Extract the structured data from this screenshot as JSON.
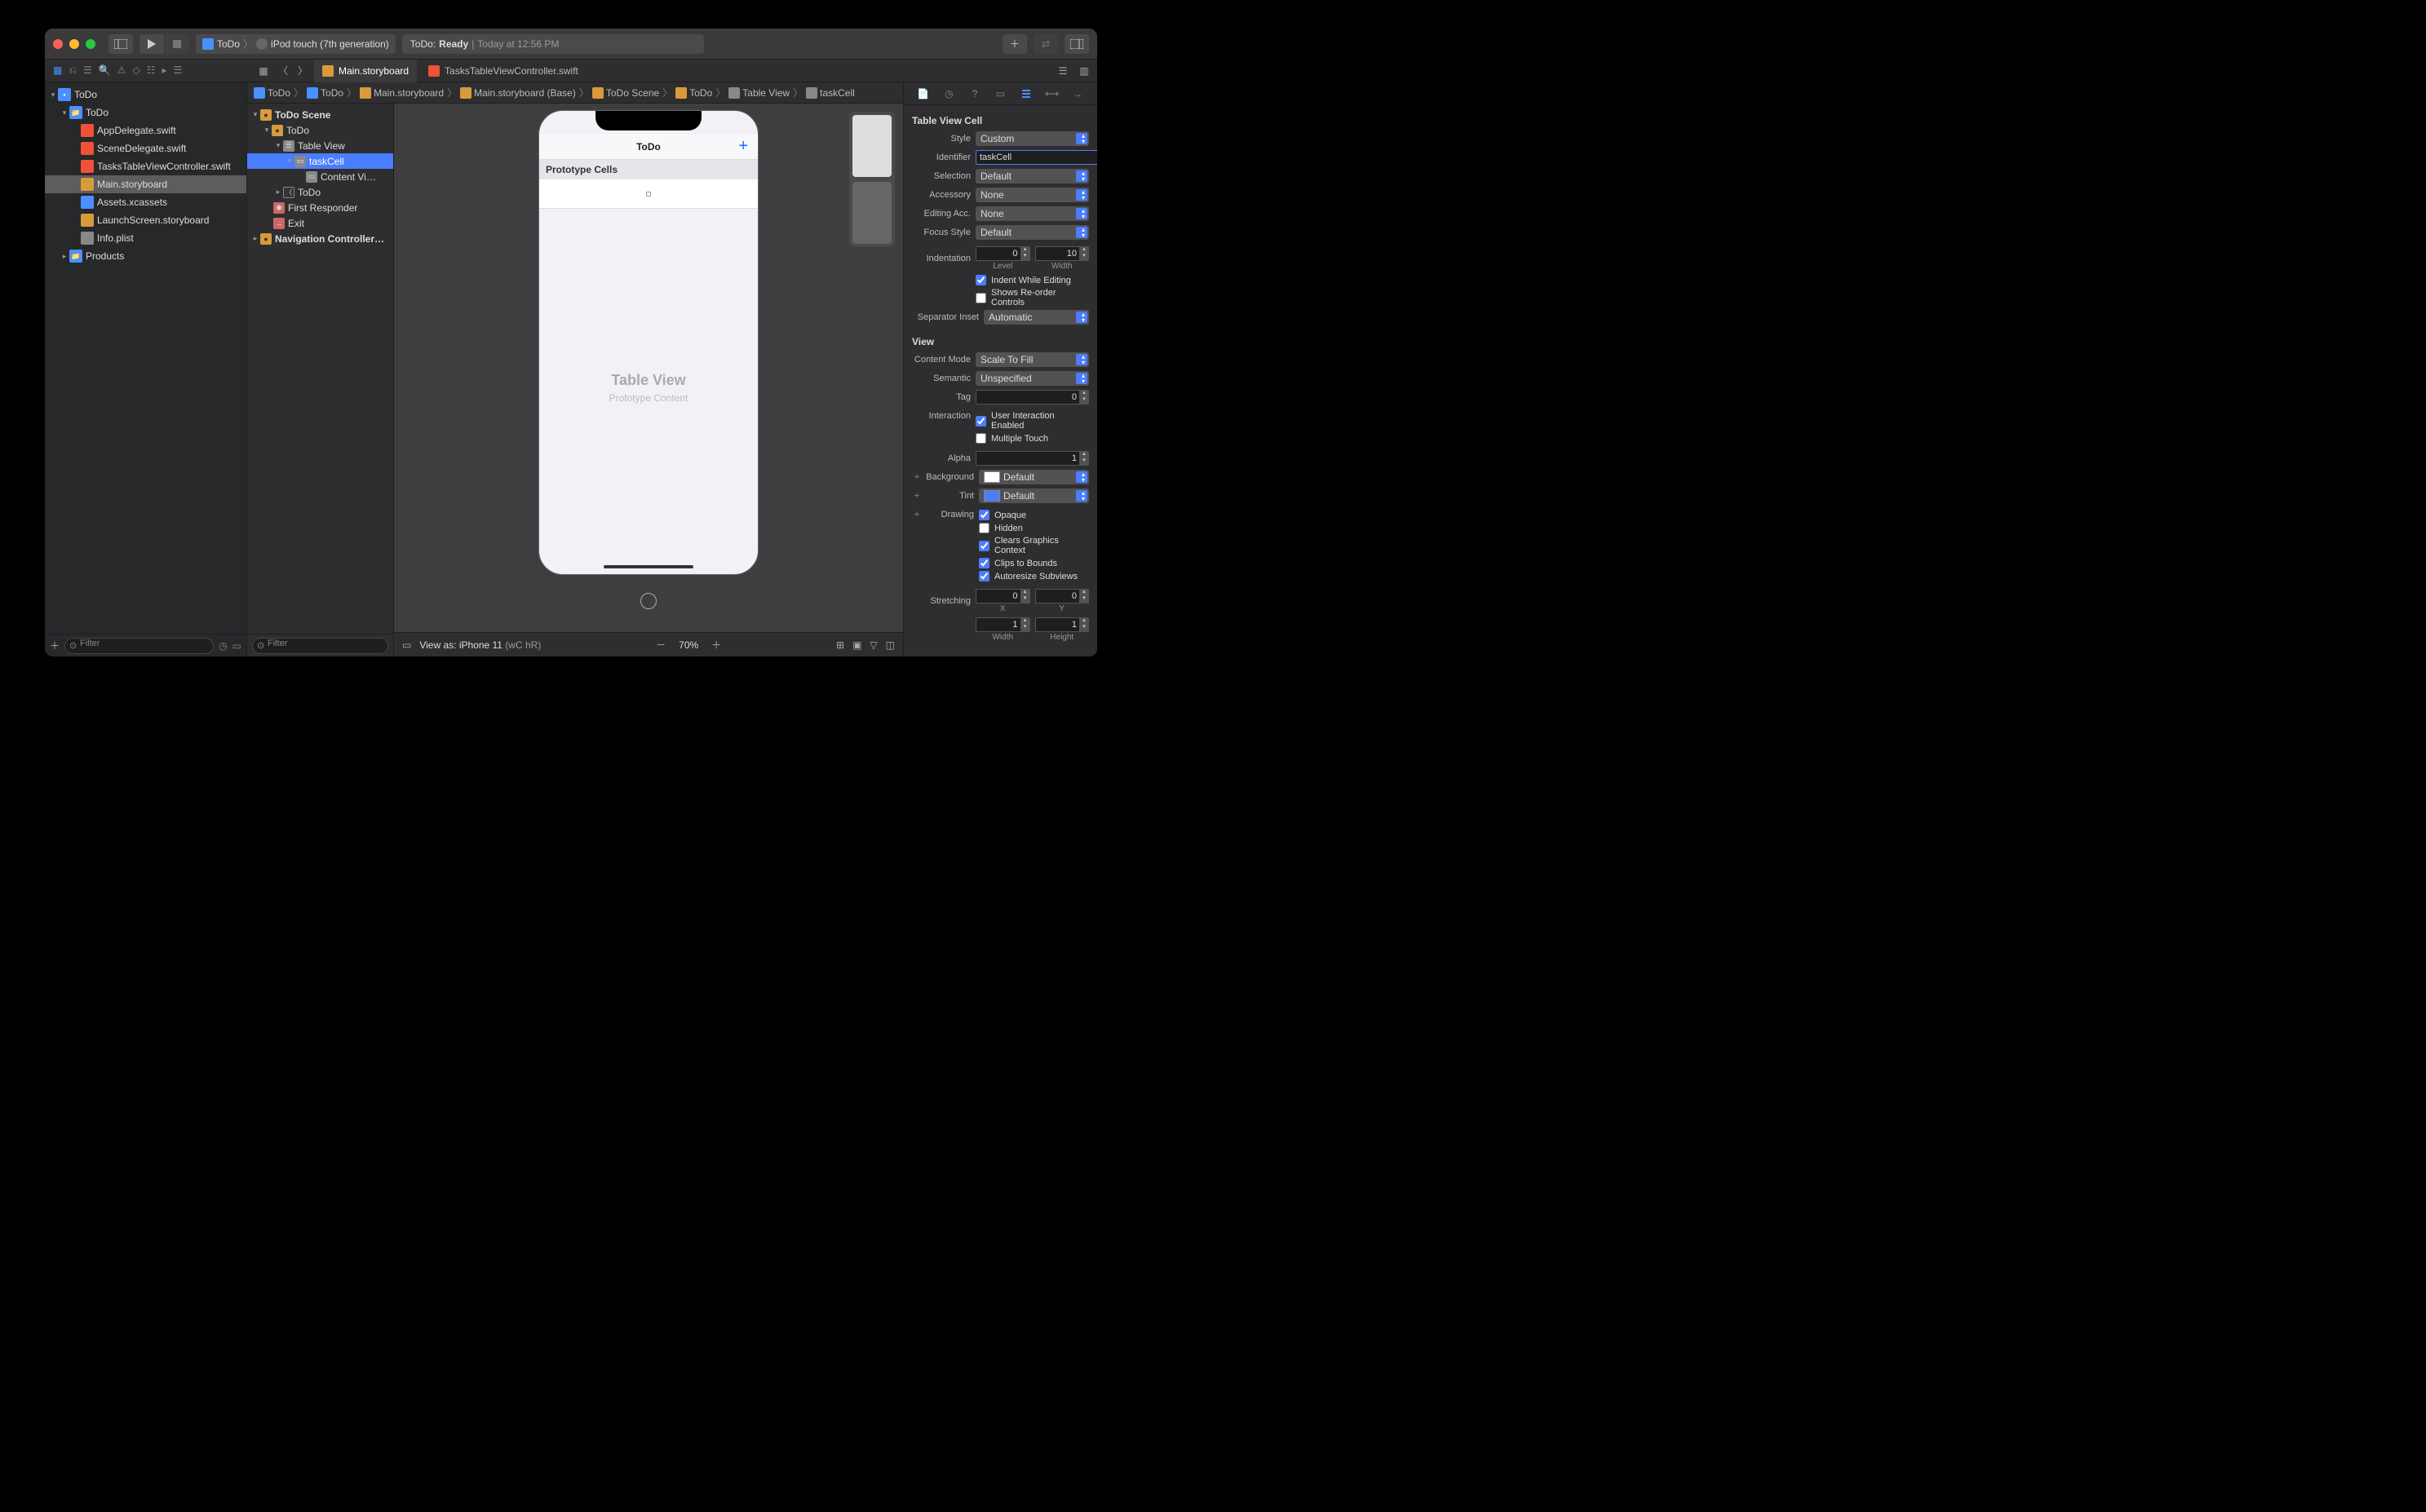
{
  "toolbar": {
    "scheme_project": "ToDo",
    "scheme_device": "iPod touch (7th generation)",
    "status_app": "ToDo:",
    "status_state": "Ready",
    "status_time": "Today at 12:56 PM"
  },
  "tabs": {
    "active": "Main.storyboard",
    "other": "TasksTableViewController.swift"
  },
  "navigator": {
    "project": "ToDo",
    "group": "ToDo",
    "files": [
      "AppDelegate.swift",
      "SceneDelegate.swift",
      "TasksTableViewController.swift",
      "Main.storyboard",
      "Assets.xcassets",
      "LaunchScreen.storyboard",
      "Info.plist"
    ],
    "products": "Products",
    "filter_placeholder": "Filter"
  },
  "jumpbar": {
    "crumbs": [
      "ToDo",
      "ToDo",
      "Main.storyboard",
      "Main.storyboard (Base)",
      "ToDo Scene",
      "ToDo",
      "Table View",
      "taskCell"
    ]
  },
  "outline": {
    "scene": "ToDo Scene",
    "vc": "ToDo",
    "tableview": "Table View",
    "cell": "taskCell",
    "contentview": "Content Vi…",
    "back": "ToDo",
    "first_responder": "First Responder",
    "exit": "Exit",
    "nav_scene": "Navigation Controller…",
    "filter_placeholder": "Filter"
  },
  "canvas": {
    "nav_title": "ToDo",
    "add": "+",
    "proto_header": "Prototype Cells",
    "tv_label": "Table View",
    "tv_sub": "Prototype Content",
    "view_as": "View as: iPhone 11",
    "size_class": "(wC hR)",
    "zoom": "70%"
  },
  "inspector": {
    "cell_section": "Table View Cell",
    "style_label": "Style",
    "style_value": "Custom",
    "identifier_label": "Identifier",
    "identifier_value": "taskCell",
    "selection_label": "Selection",
    "selection_value": "Default",
    "accessory_label": "Accessory",
    "accessory_value": "None",
    "editing_label": "Editing Acc.",
    "editing_value": "None",
    "focus_label": "Focus Style",
    "focus_value": "Default",
    "indentation_label": "Indentation",
    "indent_level": "0",
    "indent_level_sub": "Level",
    "indent_width": "10",
    "indent_width_sub": "Width",
    "indent_while_editing": "Indent While Editing",
    "reorder": "Shows Re-order Controls",
    "sep_label": "Separator Inset",
    "sep_value": "Automatic",
    "view_section": "View",
    "content_mode_label": "Content Mode",
    "content_mode_value": "Scale To Fill",
    "semantic_label": "Semantic",
    "semantic_value": "Unspecified",
    "tag_label": "Tag",
    "tag_value": "0",
    "interaction_label": "Interaction",
    "user_interaction": "User Interaction Enabled",
    "multiple_touch": "Multiple Touch",
    "alpha_label": "Alpha",
    "alpha_value": "1",
    "background_label": "Background",
    "background_value": "Default",
    "tint_label": "Tint",
    "tint_value": "Default",
    "drawing_label": "Drawing",
    "opaque": "Opaque",
    "hidden": "Hidden",
    "clears_graphics": "Clears Graphics Context",
    "clips": "Clips to Bounds",
    "autoresize": "Autoresize Subviews",
    "stretching_label": "Stretching",
    "stretch_x": "0",
    "stretch_x_sub": "X",
    "stretch_y": "0",
    "stretch_y_sub": "Y",
    "stretch_w": "1",
    "stretch_w_sub": "Width",
    "stretch_h": "1",
    "stretch_h_sub": "Height"
  }
}
